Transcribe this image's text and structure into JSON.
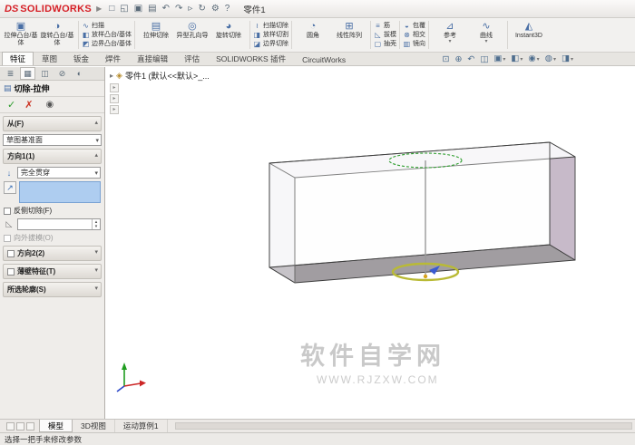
{
  "colors": {
    "brand_red": "#d61f26",
    "selection_blue": "#aecdf0",
    "preview_green": "#2f9e2f",
    "highlight_yellow": "#b9ba35",
    "face_purple": "#c7bac9",
    "face_bottom_gray": "#a19da1"
  },
  "titlebar": {
    "brand_prefix": "DS",
    "brand": "SOLIDWORKS",
    "flyout_glyph": "▶",
    "document_title": "零件1",
    "icons": [
      {
        "name": "new-file-icon",
        "glyph": "□"
      },
      {
        "name": "open-file-icon",
        "glyph": "◱"
      },
      {
        "name": "save-icon",
        "glyph": "▣"
      },
      {
        "name": "print-icon",
        "glyph": "▤"
      },
      {
        "name": "undo-icon",
        "glyph": "↶"
      },
      {
        "name": "redo-icon",
        "glyph": "↷"
      },
      {
        "name": "select-icon",
        "glyph": "▹"
      },
      {
        "name": "rebuild-icon",
        "glyph": "↻"
      },
      {
        "name": "options-icon",
        "glyph": "⚙"
      },
      {
        "name": "help-icon",
        "glyph": "?"
      }
    ]
  },
  "ribbon": {
    "groups": [
      {
        "size": "large",
        "items": [
          {
            "name": "extruded-boss",
            "label": "拉伸凸台/基体",
            "glyph": "▣"
          },
          {
            "name": "revolved-boss",
            "label": "旋转凸台/基体",
            "glyph": "◑"
          }
        ]
      },
      {
        "size": "small",
        "items": [
          {
            "name": "swept-boss",
            "label": "扫描",
            "glyph": "∿"
          },
          {
            "name": "lofted-boss",
            "label": "放样凸台/基体",
            "glyph": "◧"
          },
          {
            "name": "boundary-boss",
            "label": "边界凸台/基体",
            "glyph": "◩"
          }
        ]
      },
      {
        "size": "large",
        "items": [
          {
            "name": "extruded-cut",
            "label": "拉伸切除",
            "glyph": "▤"
          },
          {
            "name": "hole-wizard",
            "label": "异型孔向导",
            "glyph": "◎"
          },
          {
            "name": "revolved-cut",
            "label": "旋转切除",
            "glyph": "◕"
          }
        ]
      },
      {
        "size": "small",
        "items": [
          {
            "name": "swept-cut",
            "label": "扫描切除",
            "glyph": "≀"
          },
          {
            "name": "lofted-cut",
            "label": "放样切割",
            "glyph": "◨"
          },
          {
            "name": "boundary-cut",
            "label": "边界切除",
            "glyph": "◪"
          }
        ]
      },
      {
        "size": "large",
        "items": [
          {
            "name": "fillet",
            "label": "圆角",
            "glyph": "◔"
          },
          {
            "name": "linear-pattern",
            "label": "线性阵列",
            "glyph": "⊞"
          }
        ]
      },
      {
        "size": "small",
        "items": [
          {
            "name": "rib",
            "label": "筋",
            "glyph": "≡"
          },
          {
            "name": "draft",
            "label": "拔模",
            "glyph": "◺"
          },
          {
            "name": "shell",
            "label": "抽壳",
            "glyph": "▢"
          }
        ]
      },
      {
        "size": "small",
        "items": [
          {
            "name": "wrap",
            "label": "包覆",
            "glyph": "◒"
          },
          {
            "name": "intersect",
            "label": "相交",
            "glyph": "⊗"
          },
          {
            "name": "mirror",
            "label": "镜向",
            "glyph": "▥"
          }
        ]
      },
      {
        "size": "large",
        "items": [
          {
            "name": "reference-geometry",
            "label": "参考",
            "glyph": "⊿"
          },
          {
            "name": "curves",
            "label": "曲线",
            "glyph": "∿"
          }
        ]
      },
      {
        "size": "large",
        "items": [
          {
            "name": "instant3d",
            "label": "Instant3D",
            "glyph": "◭"
          }
        ]
      }
    ]
  },
  "tab_bar": {
    "tabs": [
      "特征",
      "草图",
      "钣金",
      "焊件",
      "直接编辑",
      "评估",
      "SOLIDWORKS 插件",
      "CircuitWorks"
    ],
    "active_index": 0
  },
  "headsup": {
    "icons": [
      {
        "name": "zoom-fit-icon",
        "glyph": "⊡"
      },
      {
        "name": "zoom-area-icon",
        "glyph": "⊕"
      },
      {
        "name": "previous-view-icon",
        "glyph": "↶"
      },
      {
        "name": "section-view-icon",
        "glyph": "◫"
      },
      {
        "name": "view-orientation-icon",
        "glyph": "▣"
      },
      {
        "name": "display-style-icon",
        "glyph": "◧"
      },
      {
        "name": "hide-show-items-icon",
        "glyph": "◉"
      },
      {
        "name": "edit-appearance-icon",
        "glyph": "◍"
      },
      {
        "name": "view-settings-icon",
        "glyph": "◨"
      }
    ]
  },
  "feature_tree": {
    "header": "零件1 (默认<<默认>_...",
    "expand_glyph": "▸",
    "part_icon": "◈"
  },
  "property_manager": {
    "tabs": [
      {
        "name": "featuremanager-tab",
        "glyph": "≣"
      },
      {
        "name": "propertymanager-tab",
        "glyph": "▦"
      },
      {
        "name": "configurationmanager-tab",
        "glyph": "◫"
      },
      {
        "name": "dimxpertmanager-tab",
        "glyph": "⊘"
      },
      {
        "name": "displaymanager-tab",
        "glyph": "◐"
      }
    ],
    "title": "切除-拉伸",
    "title_icon": "▤",
    "ok_icon": "✓",
    "cancel_icon": "✗",
    "preview_icon": "◉",
    "from_section": {
      "label": "从(F)",
      "value": "草图基准面"
    },
    "direction1": {
      "label": "方向1(1)",
      "condition_icon": "↓",
      "end_condition": "完全贯穿",
      "flip_icon": "↗",
      "flip_label": "反侧切除(F)",
      "draft_icon": "◺",
      "draft_value": "",
      "outward_label": "向外拔模(O)"
    },
    "direction2_label": "方向2(2)",
    "thin_feature_label": "薄壁特征(T)",
    "selected_contours_label": "所选轮廓(S)"
  },
  "viewport": {
    "watermark_line1": "软件自学网",
    "watermark_line2": "WWW.RJZXW.COM"
  },
  "bottom_bar": {
    "tabs": [
      "模型",
      "3D视图",
      "运动算例1"
    ],
    "active_index": 0
  },
  "status_bar": {
    "message": "选择一把手来修改参数"
  }
}
